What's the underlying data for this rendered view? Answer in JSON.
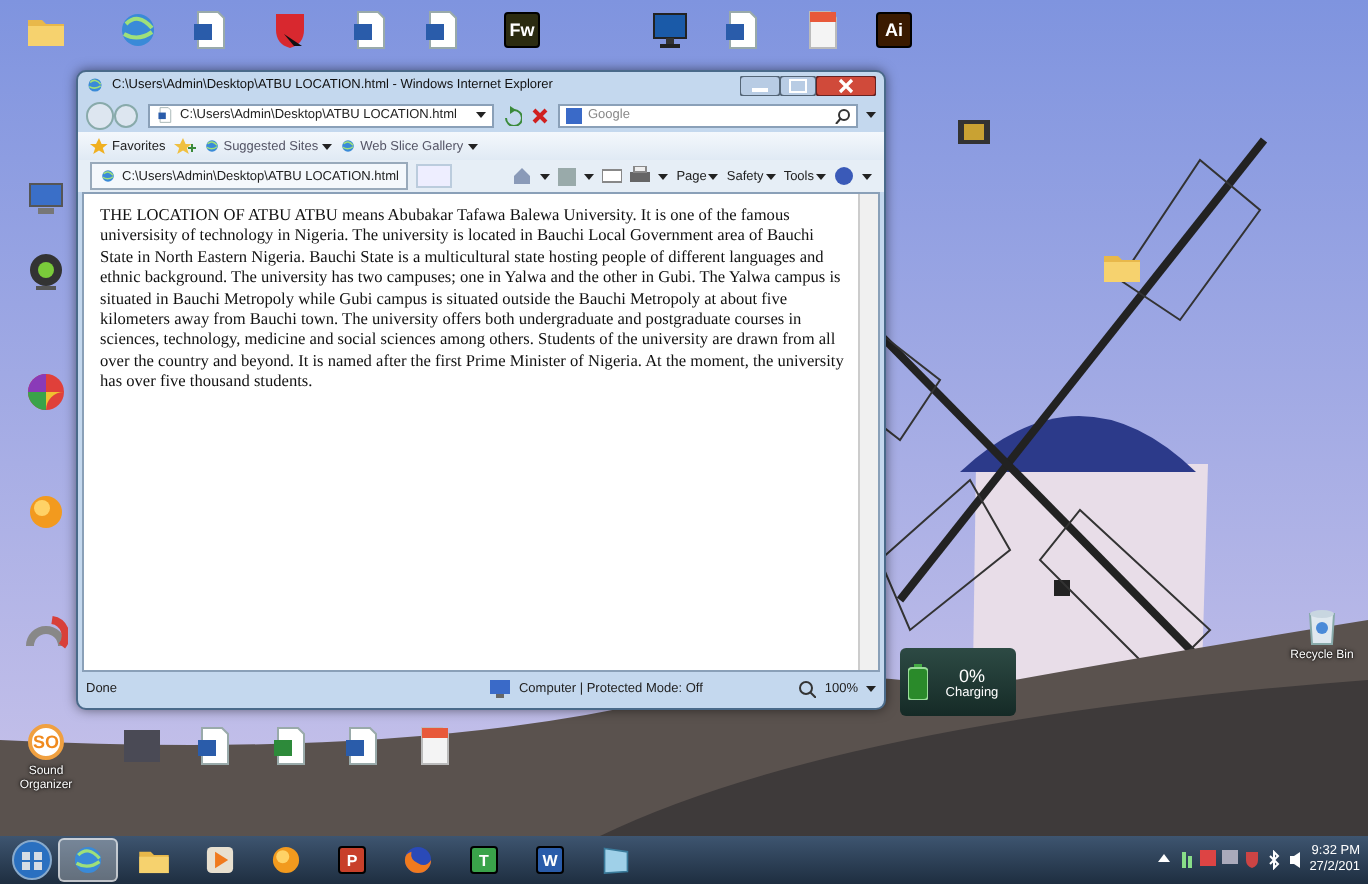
{
  "desktop": {
    "icons": [
      {
        "kind": "folder"
      },
      {
        "kind": "globe"
      },
      {
        "kind": "word"
      },
      {
        "kind": "shield"
      },
      {
        "kind": "word"
      },
      {
        "kind": "word"
      },
      {
        "kind": "tile",
        "glyph": "Fw",
        "color": "#2b2b10"
      },
      {
        "kind": "monitor"
      },
      {
        "kind": "word"
      },
      {
        "kind": "pdf"
      },
      {
        "kind": "tile",
        "glyph": "Ai",
        "color": "#3a1a00"
      },
      {
        "kind": "film"
      },
      {
        "kind": "computer"
      },
      {
        "kind": "webcam"
      },
      {
        "kind": "pinwheel"
      },
      {
        "kind": "sun"
      },
      {
        "kind": "arc"
      },
      {
        "kind": "disc",
        "glyph": "SO",
        "label": "Sound Organizer"
      },
      {
        "kind": "photo"
      },
      {
        "kind": "word"
      },
      {
        "kind": "excel"
      },
      {
        "kind": "word"
      },
      {
        "kind": "pdf"
      },
      {
        "kind": "folder"
      },
      {
        "kind": "bin",
        "label": "Recycle Bin"
      }
    ]
  },
  "browser": {
    "title": "C:\\Users\\Admin\\Desktop\\ATBU LOCATION.html - Windows Internet Explorer",
    "address": "C:\\Users\\Admin\\Desktop\\ATBU LOCATION.html",
    "search_placeholder": "Google",
    "favorites": "Favorites",
    "links": [
      "Suggested Sites",
      "Web Slice Gallery"
    ],
    "tab": "C:\\Users\\Admin\\Desktop\\ATBU LOCATION.html",
    "commands": [
      "Page",
      "Safety",
      "Tools"
    ],
    "content": "THE LOCATION OF ATBU ATBU means Abubakar Tafawa Balewa University. It is one of the famous universisity of technology in Nigeria. The university is located in Bauchi Local Government area of Bauchi State in North Eastern Nigeria. Bauchi State is a multicultural state hosting people of different languages and ethnic background. The university has two campuses; one in Yalwa and the other in Gubi. The Yalwa campus is situated in Bauchi Metropoly while Gubi campus is situated outside the Bauchi Metropoly at about five kilometers away from Bauchi town. The university offers both undergraduate and postgraduate courses in sciences, technology, medicine and social sciences among others. Students of the university are drawn from all over the country and beyond. It is named after the first Prime Minister of Nigeria. At the moment, the university has over five thousand students.",
    "status": "Done",
    "zone": "Computer | Protected Mode: Off",
    "zoom": "100%"
  },
  "battery": {
    "percent": "0%",
    "status": "Charging"
  },
  "taskbar": {
    "items": [
      {
        "kind": "globe",
        "active": true
      },
      {
        "kind": "folder",
        "active": false
      },
      {
        "kind": "play",
        "active": false
      },
      {
        "kind": "sun",
        "active": false
      },
      {
        "kind": "tile",
        "glyph": "P",
        "color": "#c8402a",
        "active": false
      },
      {
        "kind": "fox",
        "active": false
      },
      {
        "kind": "tile",
        "glyph": "T",
        "color": "#3aa34a",
        "active": false
      },
      {
        "kind": "tile",
        "glyph": "W",
        "color": "#2a5caa",
        "active": false
      },
      {
        "kind": "glass",
        "active": false
      }
    ],
    "time": "9:32 PM",
    "date": "27/2/201"
  }
}
